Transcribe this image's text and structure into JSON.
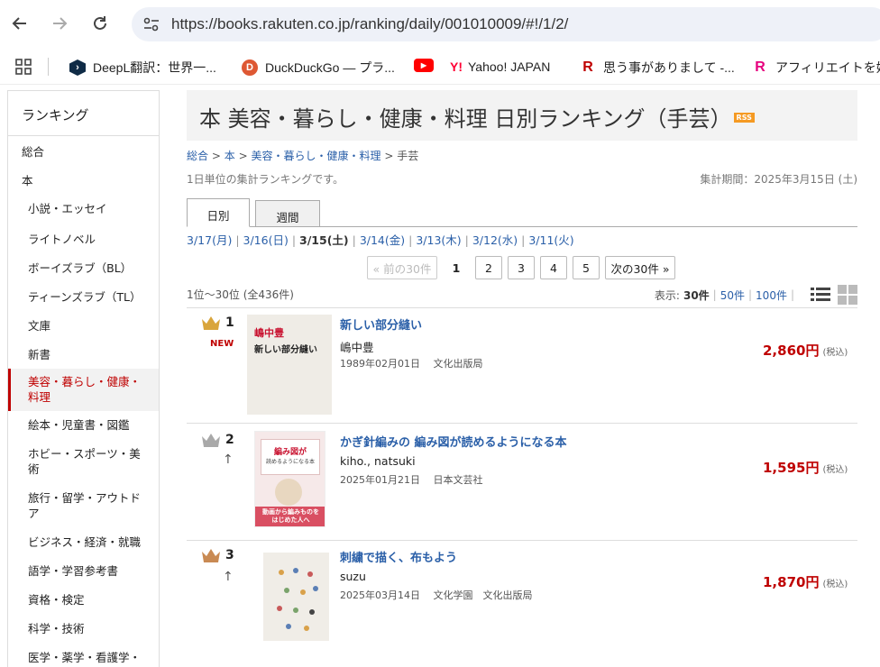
{
  "browser": {
    "url": "https://books.rakuten.co.jp/ranking/daily/001010009/#!/1/2/"
  },
  "bookmarks": [
    {
      "icon": "deepl-icon",
      "label": "DeepL翻訳：世界一..."
    },
    {
      "icon": "duckduckgo-icon",
      "label": "DuckDuckGo — プラ..."
    },
    {
      "icon": "youtube-icon",
      "label": ""
    },
    {
      "icon": "yahoo-icon",
      "label": "Yahoo! JAPAN"
    },
    {
      "icon": "rakuten-r-icon",
      "label": "思う事がありまして -..."
    },
    {
      "icon": "rakuten-r-pink-icon",
      "label": "アフィリエイトを始め"
    }
  ],
  "sidebar": {
    "title": "ランキング",
    "cat_total": "総合",
    "cat_book": "本",
    "items": [
      "小説・エッセイ",
      "ライトノベル",
      "ボーイズラブ（BL）",
      "ティーンズラブ（TL）",
      "文庫",
      "新書",
      "美容・暮らし・健康・料理",
      "絵本・児童書・図鑑",
      "ホビー・スポーツ・美術",
      "旅行・留学・アウトドア",
      "ビジネス・経済・就職",
      "語学・学習参考書",
      "資格・検定",
      "科学・技術",
      "医学・薬学・看護学・"
    ]
  },
  "header": {
    "title": "本  美容・暮らし・健康・料理  日別ランキング（手芸）",
    "rss": "RSS"
  },
  "breadcrumb": {
    "c1": "総合",
    "c2": "本",
    "c3": "美容・暮らし・健康・料理",
    "c4": "手芸",
    "sep": ">"
  },
  "note": {
    "text": "1日単位の集計ランキングです。",
    "period": "集計期間：2025年3月15日 (土)"
  },
  "tabs": {
    "daily": "日別",
    "weekly": "週間"
  },
  "dates": {
    "d1": "3/17(月)",
    "d2": "3/16(日)",
    "d3": "3/15(土)",
    "d4": "3/14(金)",
    "d5": "3/13(木)",
    "d6": "3/12(水)",
    "d7": "3/11(火)",
    "sep": "|"
  },
  "pager": {
    "prev": "« 前の30件",
    "p1": "1",
    "p2": "2",
    "p3": "3",
    "p4": "4",
    "p5": "5",
    "next": "次の30件 »"
  },
  "count": {
    "text": "1位～30位 (全436件)",
    "disp_label": "表示:",
    "opt1": "30件",
    "opt2": "50件",
    "opt3": "100件",
    "sep": "|"
  },
  "items": [
    {
      "rank": "1",
      "badge": "NEW",
      "title": "新しい部分縫い",
      "author": "嶋中豊",
      "date": "1989年02月01日",
      "publisher": "文化出版局",
      "price": "2,860円",
      "tax": "(税込)",
      "cover_author": "嶋中豊",
      "cover_title": "新しい部分縫い",
      "crown": "#d9a53b"
    },
    {
      "rank": "2",
      "arrow": "↑",
      "title": "かぎ針編みの 編み図が読めるようになる本",
      "author": "kiho., natsuki",
      "date": "2025年01月21日",
      "publisher": "日本文芸社",
      "price": "1,595円",
      "tax": "(税込)",
      "cover_top": "編み図が",
      "cover_sub": "読めるようになる本",
      "cover_band": "動画から編みものを",
      "cover_band2": "はじめた人へ",
      "crown": "#a9a9a9"
    },
    {
      "rank": "3",
      "arrow": "↑",
      "title": "刺繍で描く、布もよう",
      "author": "suzu",
      "date": "2025年03月14日",
      "publisher": "文化学園　文化出版局",
      "price": "1,870円",
      "tax": "(税込)",
      "crown": "#c98a53"
    }
  ]
}
